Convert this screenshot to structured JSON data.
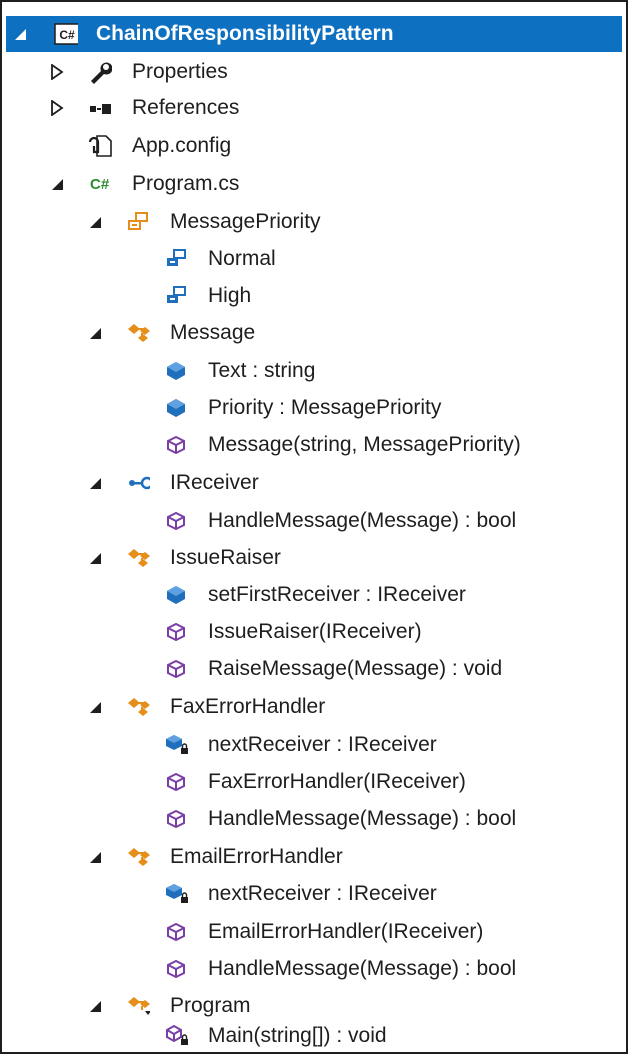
{
  "tree": {
    "items": [
      {
        "label": "ChainOfResponsibilityPattern",
        "icon": "csharp-project-icon",
        "expander": "expanded",
        "selected": true
      },
      {
        "label": "Properties",
        "icon": "wrench-icon",
        "expander": "collapsed"
      },
      {
        "label": "References",
        "icon": "references-icon",
        "expander": "collapsed"
      },
      {
        "label": "App.config",
        "icon": "config-file-icon",
        "expander": "none"
      },
      {
        "label": "Program.cs",
        "icon": "csharp-file-icon",
        "expander": "expanded"
      },
      {
        "label": "MessagePriority",
        "icon": "enum-icon",
        "expander": "expanded"
      },
      {
        "label": "Normal",
        "icon": "enum-member-icon",
        "expander": "none"
      },
      {
        "label": "High",
        "icon": "enum-member-icon",
        "expander": "none"
      },
      {
        "label": "Message",
        "icon": "class-icon",
        "expander": "expanded"
      },
      {
        "label": "Text : string",
        "icon": "field-icon",
        "expander": "none"
      },
      {
        "label": "Priority : MessagePriority",
        "icon": "field-icon",
        "expander": "none"
      },
      {
        "label": "Message(string, MessagePriority)",
        "icon": "method-icon",
        "expander": "none"
      },
      {
        "label": "IReceiver",
        "icon": "interface-icon",
        "expander": "expanded"
      },
      {
        "label": "HandleMessage(Message) : bool",
        "icon": "method-icon",
        "expander": "none"
      },
      {
        "label": "IssueRaiser",
        "icon": "class-icon",
        "expander": "expanded"
      },
      {
        "label": "setFirstReceiver : IReceiver",
        "icon": "field-icon",
        "expander": "none"
      },
      {
        "label": "IssueRaiser(IReceiver)",
        "icon": "method-icon",
        "expander": "none"
      },
      {
        "label": "RaiseMessage(Message) : void",
        "icon": "method-icon",
        "expander": "none"
      },
      {
        "label": "FaxErrorHandler",
        "icon": "class-icon",
        "expander": "expanded"
      },
      {
        "label": "nextReceiver : IReceiver",
        "icon": "private-field-icon",
        "expander": "none"
      },
      {
        "label": "FaxErrorHandler(IReceiver)",
        "icon": "method-icon",
        "expander": "none"
      },
      {
        "label": "HandleMessage(Message) : bool",
        "icon": "method-icon",
        "expander": "none"
      },
      {
        "label": "EmailErrorHandler",
        "icon": "class-icon",
        "expander": "expanded"
      },
      {
        "label": "nextReceiver : IReceiver",
        "icon": "private-field-icon",
        "expander": "none"
      },
      {
        "label": "EmailErrorHandler(IReceiver)",
        "icon": "method-icon",
        "expander": "none"
      },
      {
        "label": "HandleMessage(Message) : bool",
        "icon": "method-icon",
        "expander": "none"
      },
      {
        "label": "Program",
        "icon": "internal-class-icon",
        "expander": "expanded"
      },
      {
        "label": "Main(string[]) : void",
        "icon": "private-method-icon",
        "expander": "none"
      }
    ]
  },
  "colors": {
    "selection": "#0e70c0",
    "class": "#e58e1a",
    "field": "#1f6fbd",
    "method": "#7a3fa6",
    "csharp": "#2e8b2e"
  }
}
